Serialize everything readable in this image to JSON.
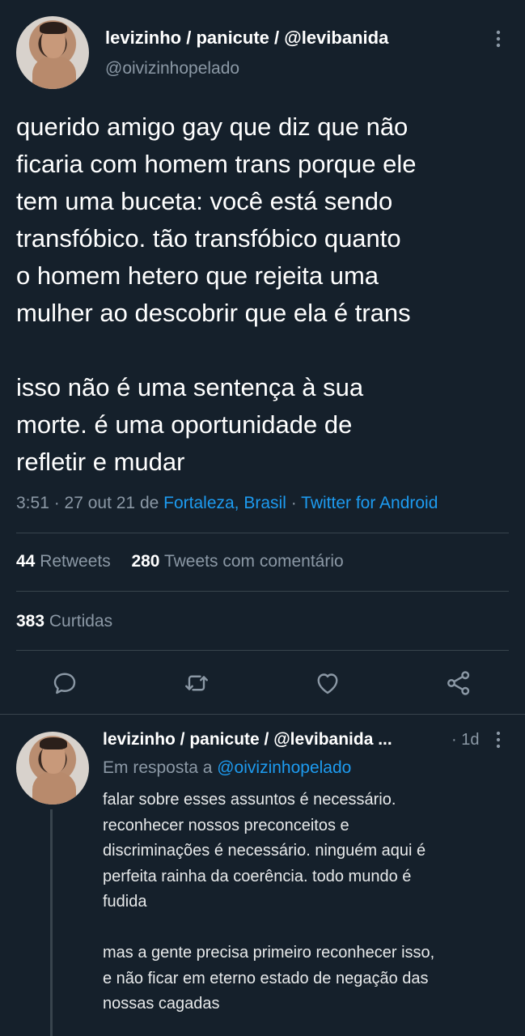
{
  "main_tweet": {
    "display_name": "levizinho / panicute / @levibanida",
    "handle": "@oivizinhopelado",
    "text_p1_lines": [
      "querido amigo gay que diz que não",
      "ficaria com homem trans porque ele",
      "tem uma buceta: você está sendo",
      "transfóbico. tão transfóbico quanto",
      "o homem hetero que rejeita uma",
      "mulher ao descobrir que ela é trans"
    ],
    "text_p2_lines": [
      "isso não é uma sentença à sua",
      "morte. é uma oportunidade de",
      "refletir e mudar"
    ],
    "time": "3:51 · 27 out 21 de ",
    "location": "Fortaleza, Brasil",
    "sep": " · ",
    "client": "Twitter for Android",
    "stats": {
      "retweets_count": "44",
      "retweets_label": "Retweets",
      "quotes_count": "280",
      "quotes_label": "Tweets com comentário",
      "likes_count": "383",
      "likes_label": "Curtidas"
    }
  },
  "reply": {
    "display_name": "levizinho / panicute / @levibanida ...",
    "age": "· 1d",
    "in_reply_prefix": "Em resposta a ",
    "in_reply_handle": "@oivizinhopelado",
    "text_p1_lines": [
      "falar sobre esses assuntos é necessário.",
      "reconhecer nossos preconceitos e",
      "discriminações é necessário. ninguém aqui é",
      "perfeita rainha da coerência. todo mundo é",
      "fudida"
    ],
    "text_p2_lines": [
      "mas a gente precisa primeiro reconhecer isso,",
      "e não ficar em eterno estado de negação das",
      "nossas cagadas"
    ]
  },
  "icons": {
    "more": "more-vertical-icon",
    "reply": "reply-icon",
    "retweet": "retweet-icon",
    "like": "heart-icon",
    "share": "share-icon"
  },
  "colors": {
    "background": "#15202b",
    "muted": "#8b98a5",
    "link": "#1d9bf0",
    "divider": "#38444d"
  }
}
